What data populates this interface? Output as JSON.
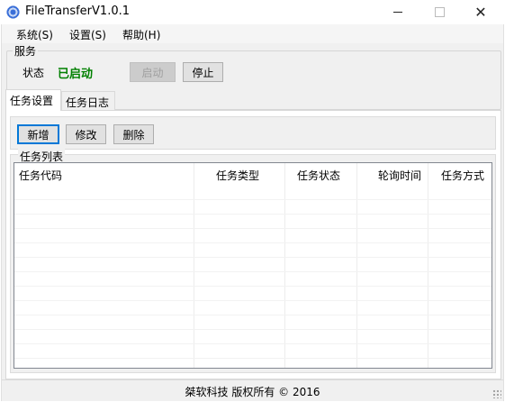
{
  "window": {
    "title": "FileTransferV1.0.1",
    "icon": "app-globe-icon"
  },
  "menu": [
    {
      "label": "系统(S)"
    },
    {
      "label": "设置(S)"
    },
    {
      "label": "帮助(H)"
    }
  ],
  "service": {
    "group_title": "服务",
    "status_label": "状态",
    "status_value": "已启动",
    "status_color": "#008000",
    "start_label": "启动",
    "stop_label": "停止"
  },
  "tabs": [
    {
      "label": "任务设置",
      "active": true
    },
    {
      "label": "任务日志",
      "active": false
    }
  ],
  "toolbar": {
    "add_label": "新增",
    "edit_label": "修改",
    "delete_label": "删除"
  },
  "task_list": {
    "group_title": "任务列表",
    "columns": [
      "任务代码",
      "任务类型",
      "任务状态",
      "轮询时间",
      "任务方式"
    ],
    "rows": []
  },
  "footer": {
    "copyright": "桀软科技 版权所有 © 2016"
  }
}
